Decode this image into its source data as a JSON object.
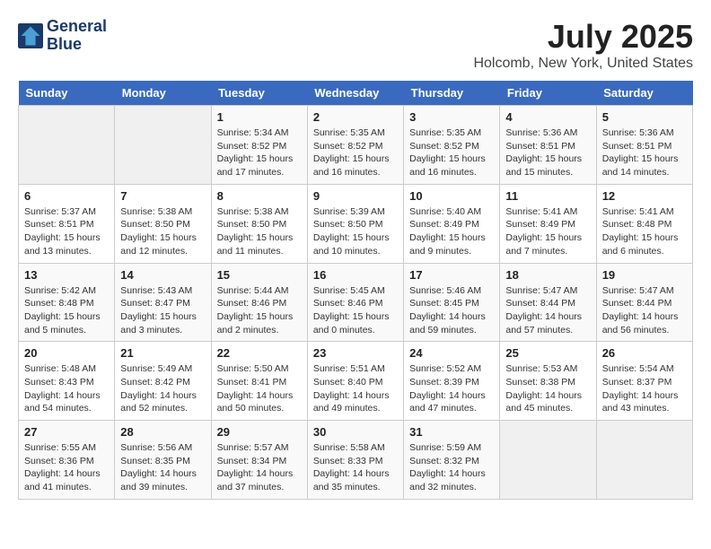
{
  "header": {
    "logo_line1": "General",
    "logo_line2": "Blue",
    "month_year": "July 2025",
    "location": "Holcomb, New York, United States"
  },
  "weekdays": [
    "Sunday",
    "Monday",
    "Tuesday",
    "Wednesday",
    "Thursday",
    "Friday",
    "Saturday"
  ],
  "weeks": [
    [
      {
        "day": "",
        "info": ""
      },
      {
        "day": "",
        "info": ""
      },
      {
        "day": "1",
        "info": "Sunrise: 5:34 AM\nSunset: 8:52 PM\nDaylight: 15 hours\nand 17 minutes."
      },
      {
        "day": "2",
        "info": "Sunrise: 5:35 AM\nSunset: 8:52 PM\nDaylight: 15 hours\nand 16 minutes."
      },
      {
        "day": "3",
        "info": "Sunrise: 5:35 AM\nSunset: 8:52 PM\nDaylight: 15 hours\nand 16 minutes."
      },
      {
        "day": "4",
        "info": "Sunrise: 5:36 AM\nSunset: 8:51 PM\nDaylight: 15 hours\nand 15 minutes."
      },
      {
        "day": "5",
        "info": "Sunrise: 5:36 AM\nSunset: 8:51 PM\nDaylight: 15 hours\nand 14 minutes."
      }
    ],
    [
      {
        "day": "6",
        "info": "Sunrise: 5:37 AM\nSunset: 8:51 PM\nDaylight: 15 hours\nand 13 minutes."
      },
      {
        "day": "7",
        "info": "Sunrise: 5:38 AM\nSunset: 8:50 PM\nDaylight: 15 hours\nand 12 minutes."
      },
      {
        "day": "8",
        "info": "Sunrise: 5:38 AM\nSunset: 8:50 PM\nDaylight: 15 hours\nand 11 minutes."
      },
      {
        "day": "9",
        "info": "Sunrise: 5:39 AM\nSunset: 8:50 PM\nDaylight: 15 hours\nand 10 minutes."
      },
      {
        "day": "10",
        "info": "Sunrise: 5:40 AM\nSunset: 8:49 PM\nDaylight: 15 hours\nand 9 minutes."
      },
      {
        "day": "11",
        "info": "Sunrise: 5:41 AM\nSunset: 8:49 PM\nDaylight: 15 hours\nand 7 minutes."
      },
      {
        "day": "12",
        "info": "Sunrise: 5:41 AM\nSunset: 8:48 PM\nDaylight: 15 hours\nand 6 minutes."
      }
    ],
    [
      {
        "day": "13",
        "info": "Sunrise: 5:42 AM\nSunset: 8:48 PM\nDaylight: 15 hours\nand 5 minutes."
      },
      {
        "day": "14",
        "info": "Sunrise: 5:43 AM\nSunset: 8:47 PM\nDaylight: 15 hours\nand 3 minutes."
      },
      {
        "day": "15",
        "info": "Sunrise: 5:44 AM\nSunset: 8:46 PM\nDaylight: 15 hours\nand 2 minutes."
      },
      {
        "day": "16",
        "info": "Sunrise: 5:45 AM\nSunset: 8:46 PM\nDaylight: 15 hours\nand 0 minutes."
      },
      {
        "day": "17",
        "info": "Sunrise: 5:46 AM\nSunset: 8:45 PM\nDaylight: 14 hours\nand 59 minutes."
      },
      {
        "day": "18",
        "info": "Sunrise: 5:47 AM\nSunset: 8:44 PM\nDaylight: 14 hours\nand 57 minutes."
      },
      {
        "day": "19",
        "info": "Sunrise: 5:47 AM\nSunset: 8:44 PM\nDaylight: 14 hours\nand 56 minutes."
      }
    ],
    [
      {
        "day": "20",
        "info": "Sunrise: 5:48 AM\nSunset: 8:43 PM\nDaylight: 14 hours\nand 54 minutes."
      },
      {
        "day": "21",
        "info": "Sunrise: 5:49 AM\nSunset: 8:42 PM\nDaylight: 14 hours\nand 52 minutes."
      },
      {
        "day": "22",
        "info": "Sunrise: 5:50 AM\nSunset: 8:41 PM\nDaylight: 14 hours\nand 50 minutes."
      },
      {
        "day": "23",
        "info": "Sunrise: 5:51 AM\nSunset: 8:40 PM\nDaylight: 14 hours\nand 49 minutes."
      },
      {
        "day": "24",
        "info": "Sunrise: 5:52 AM\nSunset: 8:39 PM\nDaylight: 14 hours\nand 47 minutes."
      },
      {
        "day": "25",
        "info": "Sunrise: 5:53 AM\nSunset: 8:38 PM\nDaylight: 14 hours\nand 45 minutes."
      },
      {
        "day": "26",
        "info": "Sunrise: 5:54 AM\nSunset: 8:37 PM\nDaylight: 14 hours\nand 43 minutes."
      }
    ],
    [
      {
        "day": "27",
        "info": "Sunrise: 5:55 AM\nSunset: 8:36 PM\nDaylight: 14 hours\nand 41 minutes."
      },
      {
        "day": "28",
        "info": "Sunrise: 5:56 AM\nSunset: 8:35 PM\nDaylight: 14 hours\nand 39 minutes."
      },
      {
        "day": "29",
        "info": "Sunrise: 5:57 AM\nSunset: 8:34 PM\nDaylight: 14 hours\nand 37 minutes."
      },
      {
        "day": "30",
        "info": "Sunrise: 5:58 AM\nSunset: 8:33 PM\nDaylight: 14 hours\nand 35 minutes."
      },
      {
        "day": "31",
        "info": "Sunrise: 5:59 AM\nSunset: 8:32 PM\nDaylight: 14 hours\nand 32 minutes."
      },
      {
        "day": "",
        "info": ""
      },
      {
        "day": "",
        "info": ""
      }
    ]
  ]
}
